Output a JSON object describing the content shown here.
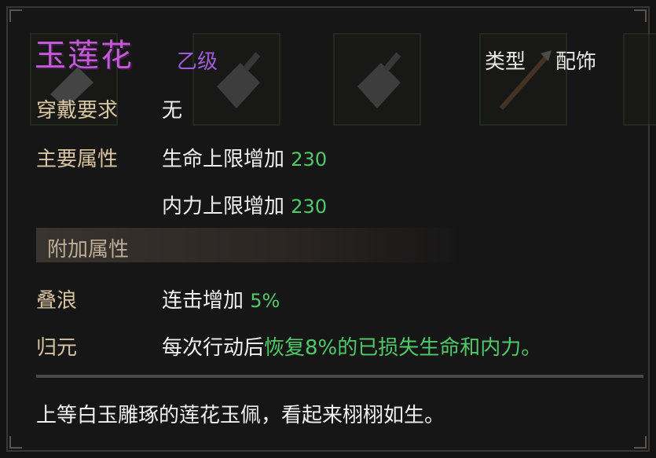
{
  "item": {
    "name": "玉莲花",
    "grade": "乙级",
    "type_label": "类型",
    "type_value": "配饰"
  },
  "requirements": {
    "label": "穿戴要求",
    "value": "无"
  },
  "main_attributes": {
    "label": "主要属性",
    "items": [
      {
        "text": "生命上限增加",
        "value": "230"
      },
      {
        "text": "内力上限增加",
        "value": "230"
      }
    ]
  },
  "extra_section": {
    "title": "附加属性"
  },
  "extra_attributes": [
    {
      "name": "叠浪",
      "text": "连击增加",
      "value": "5%"
    },
    {
      "name": "归元",
      "text_prefix": "每次行动后",
      "text_highlight": "恢复8%的已损失生命和内力。"
    }
  ],
  "description": "上等白玉雕琢的莲花玉佩，看起来栩栩如生。",
  "colors": {
    "title": "#c45ad8",
    "grade": "#a05cd8",
    "label": "#d8c49f",
    "number": "#4ecb68"
  }
}
